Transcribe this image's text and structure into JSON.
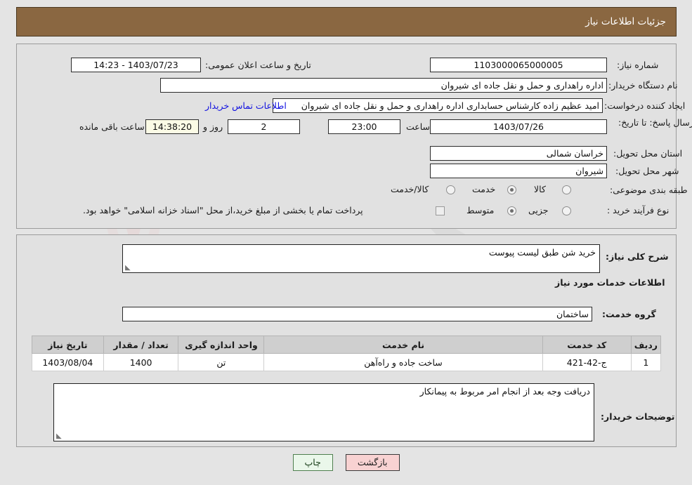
{
  "header": {
    "title": "جزئیات اطلاعات نیاز"
  },
  "top_panel": {
    "need_number": {
      "label": "شماره نیاز:",
      "value": "1103000065000005"
    },
    "announcement": {
      "label": "تاریخ و ساعت اعلان عمومی:",
      "value": "1403/07/23 - 14:23"
    },
    "buyer_org": {
      "label": "نام دستگاه خریدار:",
      "value": "اداره راهداری و حمل و نقل جاده ای شیروان"
    },
    "creator": {
      "label": "ایجاد کننده درخواست:",
      "value": "امید عظیم زاده کارشناس حسابداری اداره راهداری و حمل و نقل جاده ای شیروان",
      "contact_link": "اطلاعات تماس خریدار"
    },
    "deadline": {
      "label": "مهلت ارسال پاسخ: تا تاریخ:",
      "date": "1403/07/26",
      "time_label": "ساعت",
      "time": "23:00",
      "days": "2",
      "days_label": "روز و",
      "countdown": "14:38:20",
      "remaining_label": "ساعت باقی مانده"
    },
    "province": {
      "label": "استان محل تحویل:",
      "value": "خراسان شمالی"
    },
    "city": {
      "label": "شهر محل تحویل:",
      "value": "شیروان"
    },
    "category": {
      "label": "طبقه بندی موضوعی:",
      "options": [
        "کالا",
        "خدمت",
        "کالا/خدمت"
      ],
      "selected": "خدمت"
    },
    "process_type": {
      "label": "نوع فرآیند خرید :",
      "options": [
        "جزیی",
        "متوسط"
      ],
      "selected": "متوسط",
      "treasury_note": "پرداخت تمام یا بخشی از مبلغ خرید،از محل \"اسناد خزانه اسلامی\" خواهد بود.",
      "treasury_checked": false
    }
  },
  "bottom_panel": {
    "need_description": {
      "label": "شرح کلی نیاز:",
      "value": "خرید شن طبق لیست پیوست"
    },
    "services_heading": "اطلاعات خدمات مورد نیاز",
    "service_group": {
      "label": "گروه خدمت:",
      "value": "ساختمان"
    },
    "table": {
      "columns": [
        "ردیف",
        "کد خدمت",
        "نام خدمت",
        "واحد اندازه گیری",
        "تعداد / مقدار",
        "تاریخ نیاز"
      ],
      "rows": [
        {
          "row": "1",
          "code": "ج-42-421",
          "name": "ساخت جاده و راه‌آهن",
          "unit": "تن",
          "quantity": "1400",
          "need_date": "1403/08/04"
        }
      ]
    },
    "buyer_notes": {
      "label": "توضیحات خریدار:",
      "value": "دریافت وجه بعد از انجام امر مربوط به پیمانکار"
    }
  },
  "buttons": {
    "print": "چاپ",
    "back": "بازگشت"
  },
  "colors": {
    "header_bg": "#8a6741",
    "page_bg": "#e4e4e4",
    "panel_bg": "#e1e1e1",
    "link": "#1010e0",
    "table_header_bg": "#cfcfcf",
    "print_btn_bg": "#eaf7ea",
    "back_btn_bg": "#f8d2d2",
    "countdown_bg": "#fbfbe6"
  },
  "watermark": {
    "text": "AriaTender.net"
  }
}
